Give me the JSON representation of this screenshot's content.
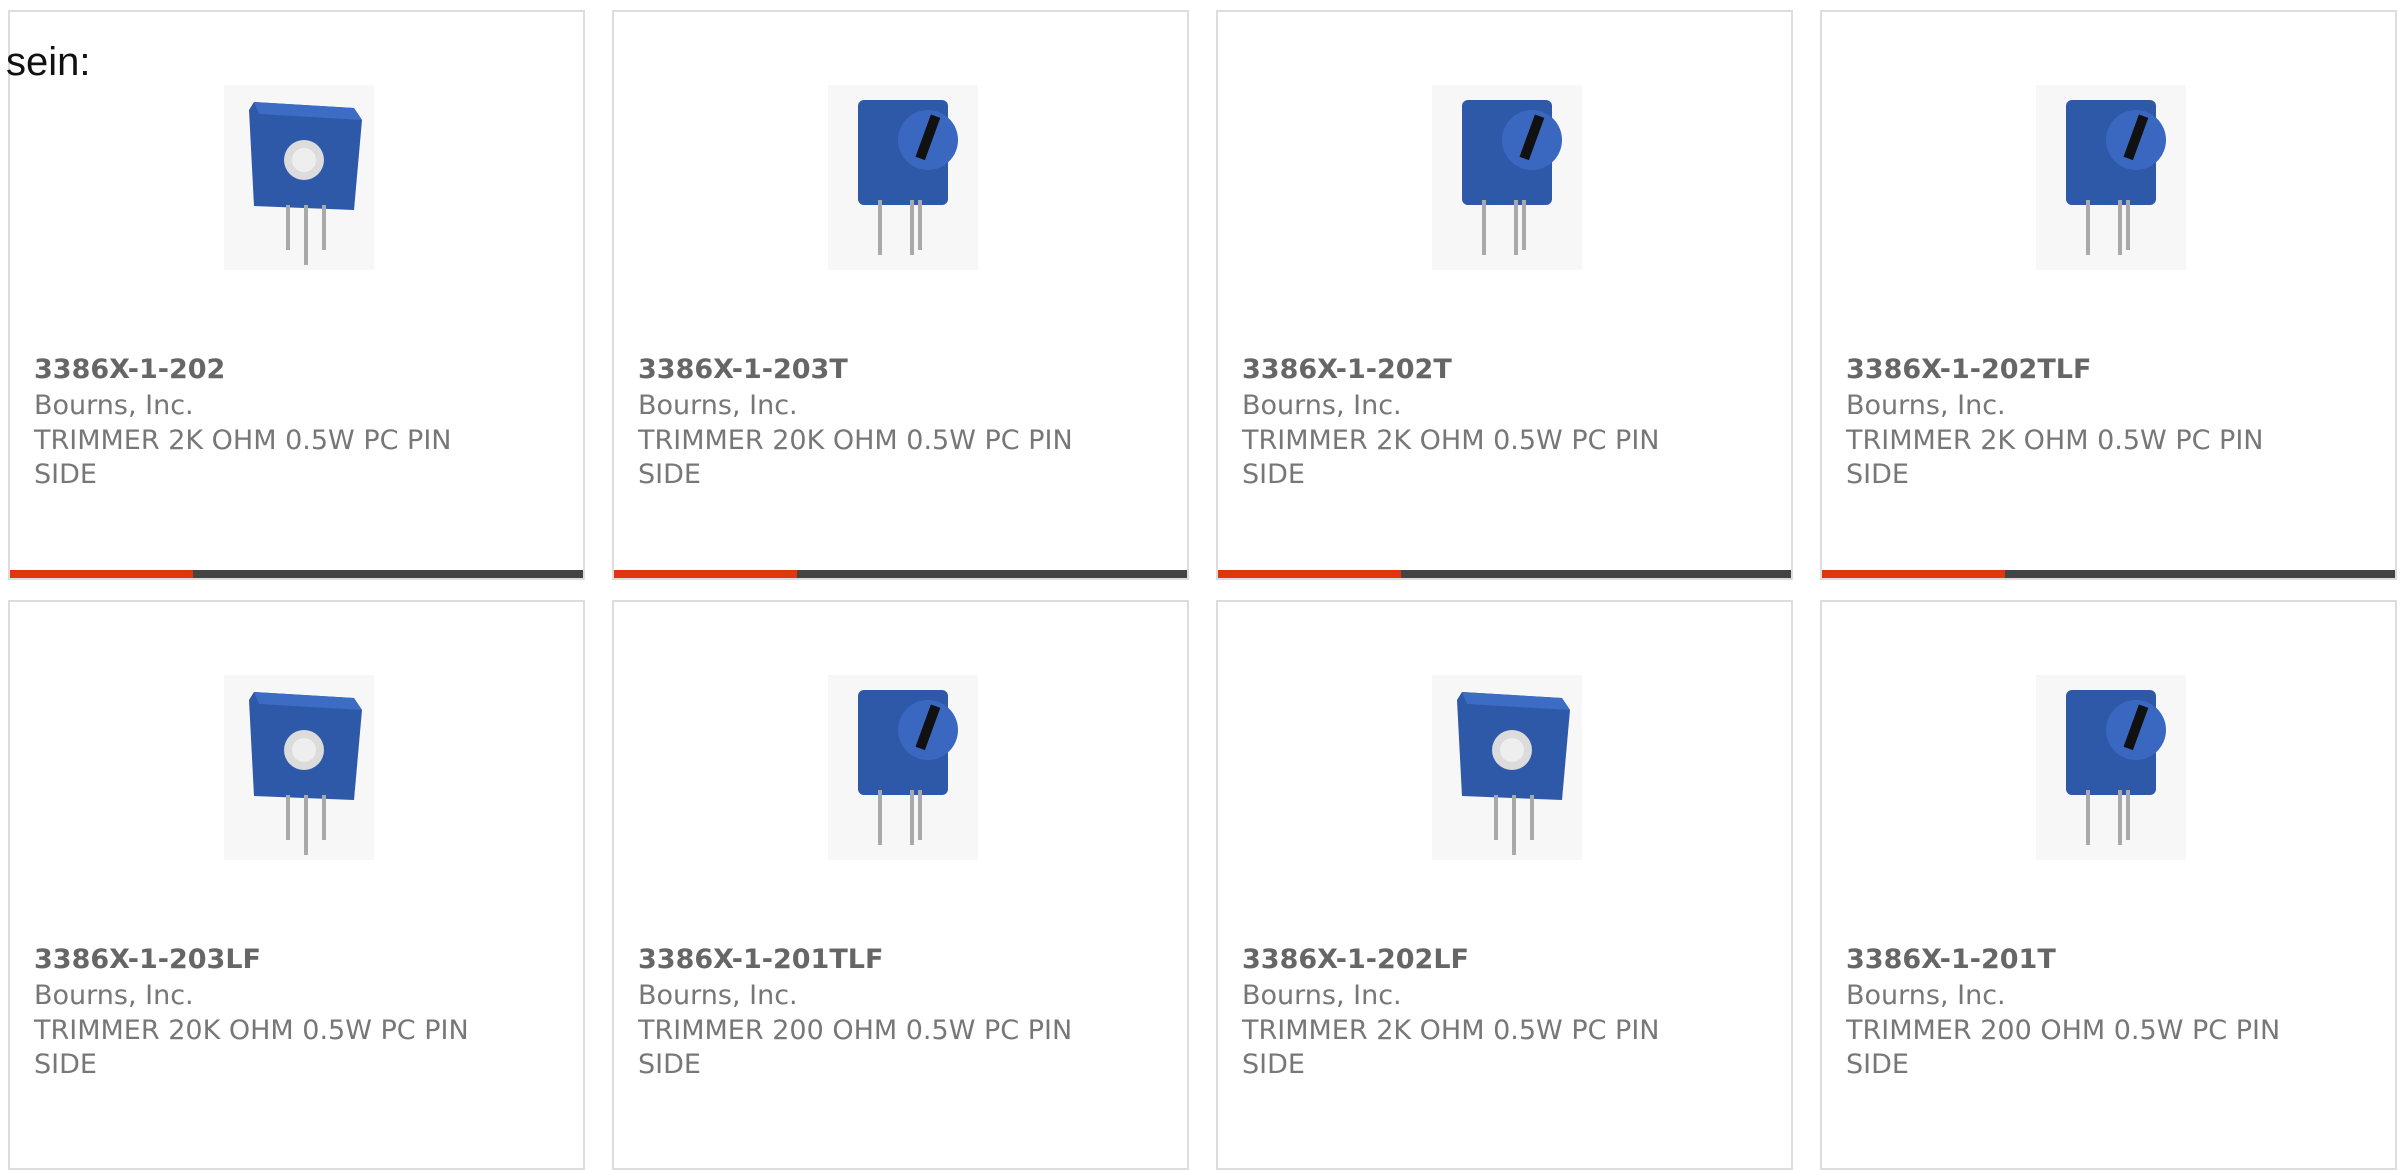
{
  "intro_text": "sein:",
  "colors": {
    "accent": "#e0360f",
    "bar_track": "#444444",
    "body_blue": "#2e58a8",
    "card_border": "#dddddd"
  },
  "products": [
    {
      "part": "3386X-1-202",
      "manufacturer": "Bourns, Inc.",
      "description": "TRIMMER 2K OHM 0.5W PC PIN SIDE",
      "image_icon": "trimmer-top-adjust-icon",
      "progress": 0.32
    },
    {
      "part": "3386X-1-203T",
      "manufacturer": "Bourns, Inc.",
      "description": "TRIMMER 20K OHM 0.5W PC PIN SIDE",
      "image_icon": "trimmer-side-adjust-icon",
      "progress": 0.32
    },
    {
      "part": "3386X-1-202T",
      "manufacturer": "Bourns, Inc.",
      "description": "TRIMMER 2K OHM 0.5W PC PIN SIDE",
      "image_icon": "trimmer-side-adjust-icon",
      "progress": 0.32
    },
    {
      "part": "3386X-1-202TLF",
      "manufacturer": "Bourns, Inc.",
      "description": "TRIMMER 2K OHM 0.5W PC PIN SIDE",
      "image_icon": "trimmer-side-adjust-icon",
      "progress": 0.32
    },
    {
      "part": "3386X-1-203LF",
      "manufacturer": "Bourns, Inc.",
      "description": "TRIMMER 20K OHM 0.5W PC PIN SIDE",
      "image_icon": "trimmer-top-adjust-icon"
    },
    {
      "part": "3386X-1-201TLF",
      "manufacturer": "Bourns, Inc.",
      "description": "TRIMMER 200 OHM 0.5W PC PIN SIDE",
      "image_icon": "trimmer-side-adjust-icon"
    },
    {
      "part": "3386X-1-202LF",
      "manufacturer": "Bourns, Inc.",
      "description": "TRIMMER 2K OHM 0.5W PC PIN SIDE",
      "image_icon": "trimmer-top-adjust-icon"
    },
    {
      "part": "3386X-1-201T",
      "manufacturer": "Bourns, Inc.",
      "description": "TRIMMER 200 OHM 0.5W PC PIN SIDE",
      "image_icon": "trimmer-side-adjust-icon"
    }
  ]
}
